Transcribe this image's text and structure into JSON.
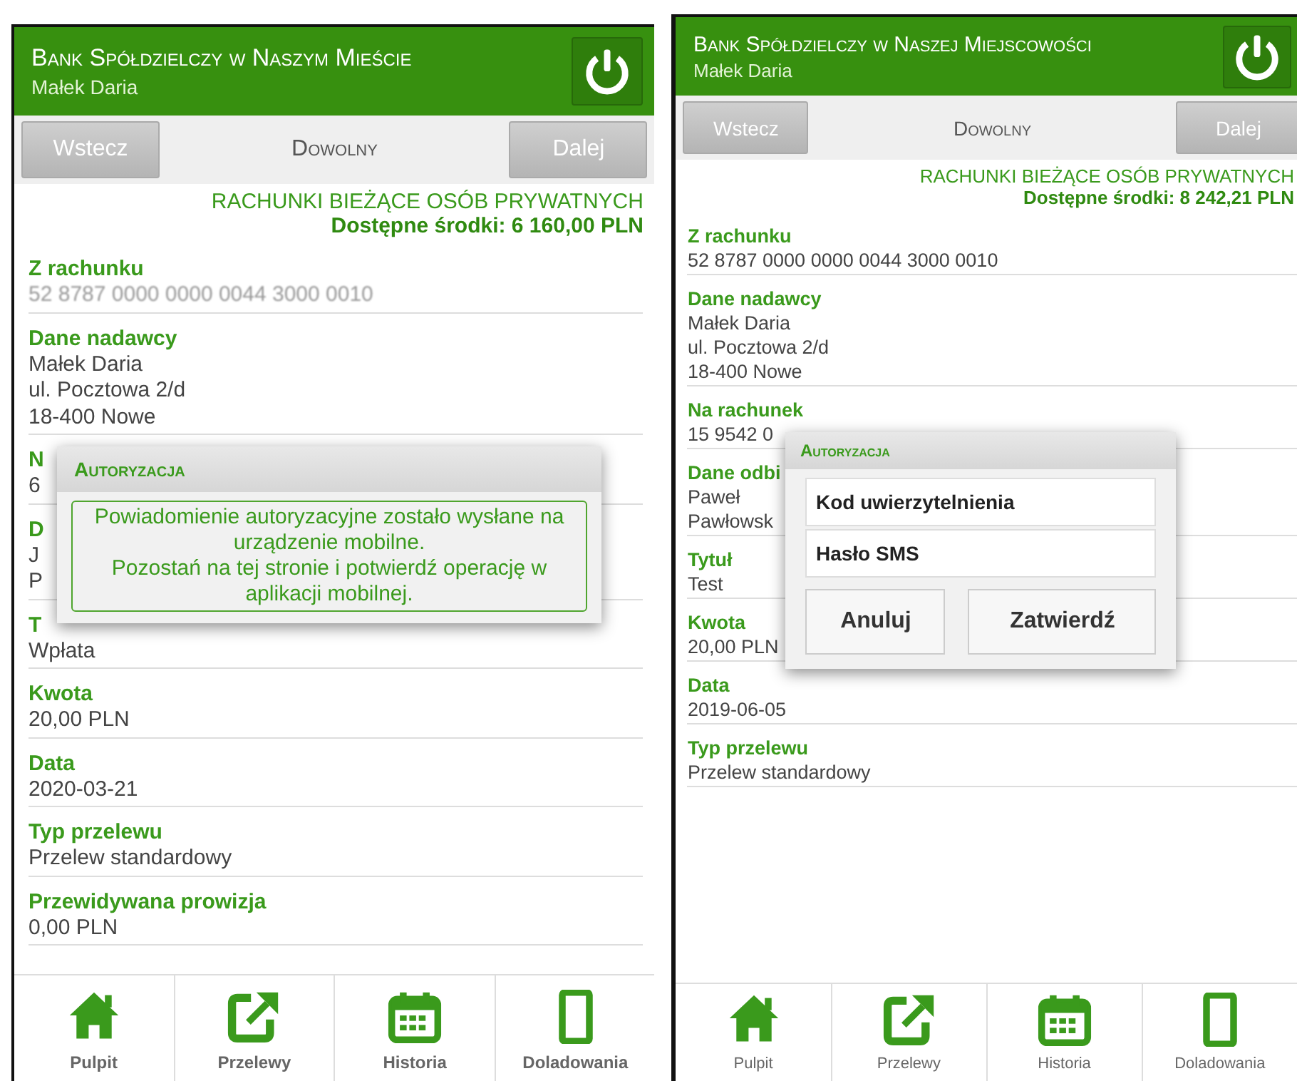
{
  "screens": [
    {
      "header": {
        "bank": "Bank Spółdzielczy w Naszym Mieście",
        "user": "Małek Daria"
      },
      "nav": {
        "back": "Wstecz",
        "title": "Dowolny",
        "next": "Dalej"
      },
      "account": {
        "type": "RACHUNKI BIEŻĄCE OSÓB PRYWATNYCH",
        "funds": "Dostępne środki: 6 160,00 PLN"
      },
      "fields": [
        {
          "label": "Z rachunku",
          "lines": [
            "52 8787 0000 0000 0044 3000 0010"
          ],
          "blurred": true
        },
        {
          "label": "Dane nadawcy",
          "lines": [
            "Małek Daria",
            "ul. Pocztowa 2/d",
            "18-400 Nowe"
          ]
        },
        {
          "label": "N",
          "lines": [
            "6"
          ]
        },
        {
          "label": "D",
          "lines": [
            "J",
            "P"
          ]
        },
        {
          "label": "T",
          "lines": [
            "Wpłata"
          ]
        },
        {
          "label": "Kwota",
          "lines": [
            "20,00 PLN"
          ]
        },
        {
          "label": "Data",
          "lines": [
            "2020-03-21"
          ]
        },
        {
          "label": "Typ przelewu",
          "lines": [
            "Przelew standardowy"
          ]
        },
        {
          "label": "Przewidywana prowizja",
          "lines": [
            "0,00 PLN"
          ]
        }
      ],
      "dialog": {
        "kind": "message",
        "title": "Autoryzacja",
        "message": "Powiadomienie autoryzacyjne zostało wysłane na urządzenie mobilne.\nPozostań na tej stronie i potwierdź operację w aplikacji mobilnej."
      },
      "tabs": [
        "Pulpit",
        "Przelewy",
        "Historia",
        "Doladowania"
      ]
    },
    {
      "header": {
        "bank": "Bank Spółdzielczy w Naszej Miejscowości",
        "user": "Małek Daria"
      },
      "nav": {
        "back": "Wstecz",
        "title": "Dowolny",
        "next": "Dalej"
      },
      "account": {
        "type": "RACHUNKI BIEŻĄCE OSÓB PRYWATNYCH",
        "funds": "Dostępne środki: 8 242,21 PLN"
      },
      "fields": [
        {
          "label": "Z rachunku",
          "lines": [
            "52 8787 0000 0000 0044 3000 0010"
          ],
          "blurred": false
        },
        {
          "label": "Dane nadawcy",
          "lines": [
            "Małek Daria",
            "ul. Pocztowa 2/d",
            "18-400 Nowe"
          ]
        },
        {
          "label": "Na rachunek",
          "lines": [
            "15 9542 0"
          ]
        },
        {
          "label": "Dane odbi",
          "lines": [
            "Paweł",
            "Pawłowsk"
          ]
        },
        {
          "label": "Tytuł",
          "lines": [
            "Test"
          ]
        },
        {
          "label": "Kwota",
          "lines": [
            "20,00 PLN"
          ]
        },
        {
          "label": "Data",
          "lines": [
            "2019-06-05"
          ]
        },
        {
          "label": "Typ przelewu",
          "lines": [
            "Przelew standardowy"
          ]
        }
      ],
      "dialog": {
        "kind": "form",
        "title": "Autoryzacja",
        "inputs": [
          {
            "placeholder": "Kod uwierzytelnienia"
          },
          {
            "placeholder": "Hasło SMS"
          }
        ],
        "buttons": [
          "Anuluj",
          "Zatwierdź"
        ]
      },
      "tabs": [
        "Pulpit",
        "Przelewy",
        "Historia",
        "Doladowania"
      ]
    }
  ]
}
